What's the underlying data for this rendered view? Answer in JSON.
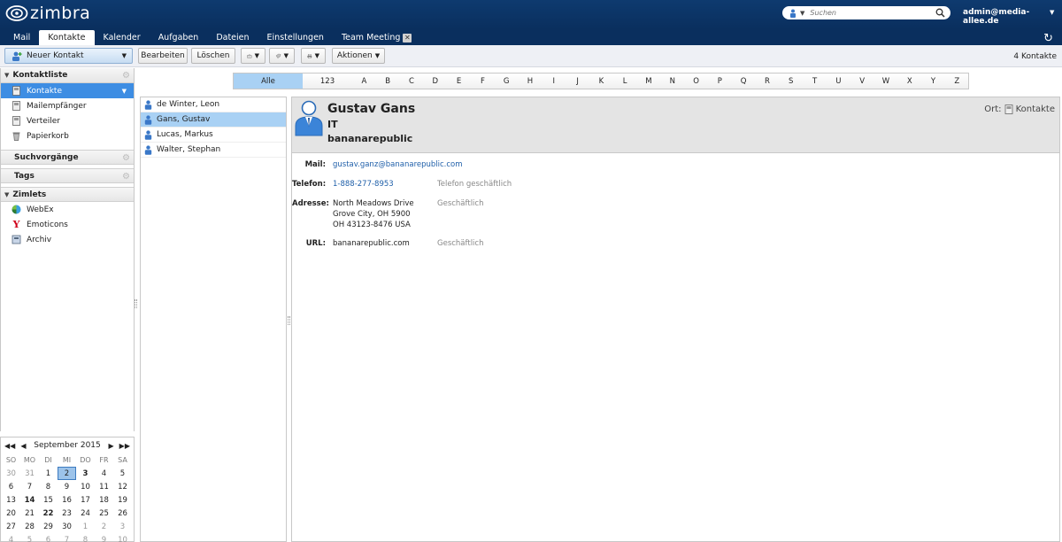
{
  "header": {
    "logo_text": "zimbra",
    "search_placeholder": "Suchen",
    "user": "admin@media-allee.de"
  },
  "app_tabs": [
    {
      "label": "Mail",
      "active": false
    },
    {
      "label": "Kontakte",
      "active": true
    },
    {
      "label": "Kalender",
      "active": false
    },
    {
      "label": "Aufgaben",
      "active": false
    },
    {
      "label": "Dateien",
      "active": false
    },
    {
      "label": "Einstellungen",
      "active": false
    },
    {
      "label": "Team Meeting",
      "active": false,
      "closable": true
    }
  ],
  "toolbar": {
    "new_contact": "Neuer Kontakt",
    "edit": "Bearbeiten",
    "delete": "Löschen",
    "actions": "Aktionen",
    "count": "4 Kontakte"
  },
  "sidebar": {
    "contact_list_title": "Kontaktliste",
    "items": [
      {
        "label": "Kontakte",
        "icon": "address-book-icon"
      },
      {
        "label": "Mailempfänger",
        "icon": "address-book-icon"
      },
      {
        "label": "Verteiler",
        "icon": "address-book-icon"
      },
      {
        "label": "Papierkorb",
        "icon": "trash-icon"
      }
    ],
    "searches_title": "Suchvorgänge",
    "tags_title": "Tags",
    "zimlets_title": "Zimlets",
    "zimlets": [
      {
        "label": "WebEx",
        "icon": "webex-icon"
      },
      {
        "label": "Emoticons",
        "icon": "yahoo-emoticons-icon"
      },
      {
        "label": "Archiv",
        "icon": "archive-icon"
      }
    ]
  },
  "calendar": {
    "month": "September 2015",
    "dow": [
      "SO",
      "MO",
      "DI",
      "MI",
      "DO",
      "FR",
      "SA"
    ],
    "days": [
      [
        "30",
        "31",
        "1",
        "2",
        "3",
        "4",
        "5"
      ],
      [
        "6",
        "7",
        "8",
        "9",
        "10",
        "11",
        "12"
      ],
      [
        "13",
        "14",
        "15",
        "16",
        "17",
        "18",
        "19"
      ],
      [
        "20",
        "21",
        "22",
        "23",
        "24",
        "25",
        "26"
      ],
      [
        "27",
        "28",
        "29",
        "30",
        "1",
        "2",
        "3"
      ],
      [
        "4",
        "5",
        "6",
        "7",
        "8",
        "9",
        "10"
      ]
    ]
  },
  "alphabet": [
    "Alle",
    "123",
    "A",
    "B",
    "C",
    "D",
    "E",
    "F",
    "G",
    "H",
    "I",
    "J",
    "K",
    "L",
    "M",
    "N",
    "O",
    "P",
    "Q",
    "R",
    "S",
    "T",
    "U",
    "V",
    "W",
    "X",
    "Y",
    "Z"
  ],
  "contacts": [
    {
      "name": "de Winter, Leon"
    },
    {
      "name": "Gans, Gustav"
    },
    {
      "name": "Lucas, Markus"
    },
    {
      "name": "Walter, Stephan"
    }
  ],
  "detail": {
    "name": "Gustav Gans",
    "department": "IT",
    "company": "bananarepublic",
    "location_label": "Ort:",
    "location_value": "Kontakte",
    "mail_label": "Mail:",
    "mail_value": "gustav.ganz@bananarepublic.com",
    "phone_label": "Telefon:",
    "phone_value": "1-888-277-8953",
    "phone_type": "Telefon geschäftlich",
    "address_label": "Adresse:",
    "address_line1": "North Meadows Drive",
    "address_line2": "Grove City, OH 5900",
    "address_line3": "OH 43123-8476 USA",
    "address_type": "Geschäftlich",
    "url_label": "URL:",
    "url_value": "bananarepublic.com",
    "url_type": "Geschäftlich"
  },
  "colors": {
    "header_bg": "#0a2f5e",
    "selection": "#3d8de3",
    "selection_light": "#a9d1f4",
    "link": "#1f5fa9"
  }
}
